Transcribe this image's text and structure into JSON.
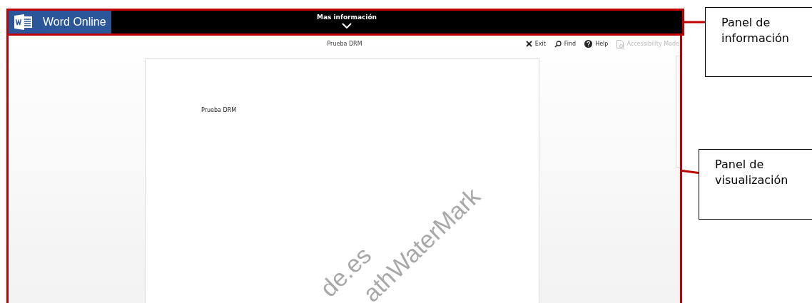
{
  "app": {
    "title": "Word Online"
  },
  "info_bar": {
    "label": "Mas información"
  },
  "viewer": {
    "document_title": "Prueba DRM",
    "toolbar": [
      {
        "kind": "exit",
        "label": "Exit",
        "disabled": false
      },
      {
        "kind": "find",
        "label": "Find",
        "disabled": false
      },
      {
        "kind": "help",
        "label": "Help",
        "disabled": false
      },
      {
        "kind": "accessibility",
        "label": "Accessibility Mode",
        "disabled": true
      }
    ],
    "page": {
      "body_text": "Prueba DRM",
      "watermark": [
        "de.es",
        "athWaterMark"
      ]
    }
  },
  "annotations": [
    {
      "text": "Panel de información"
    },
    {
      "text": "Panel de visualización"
    }
  ]
}
